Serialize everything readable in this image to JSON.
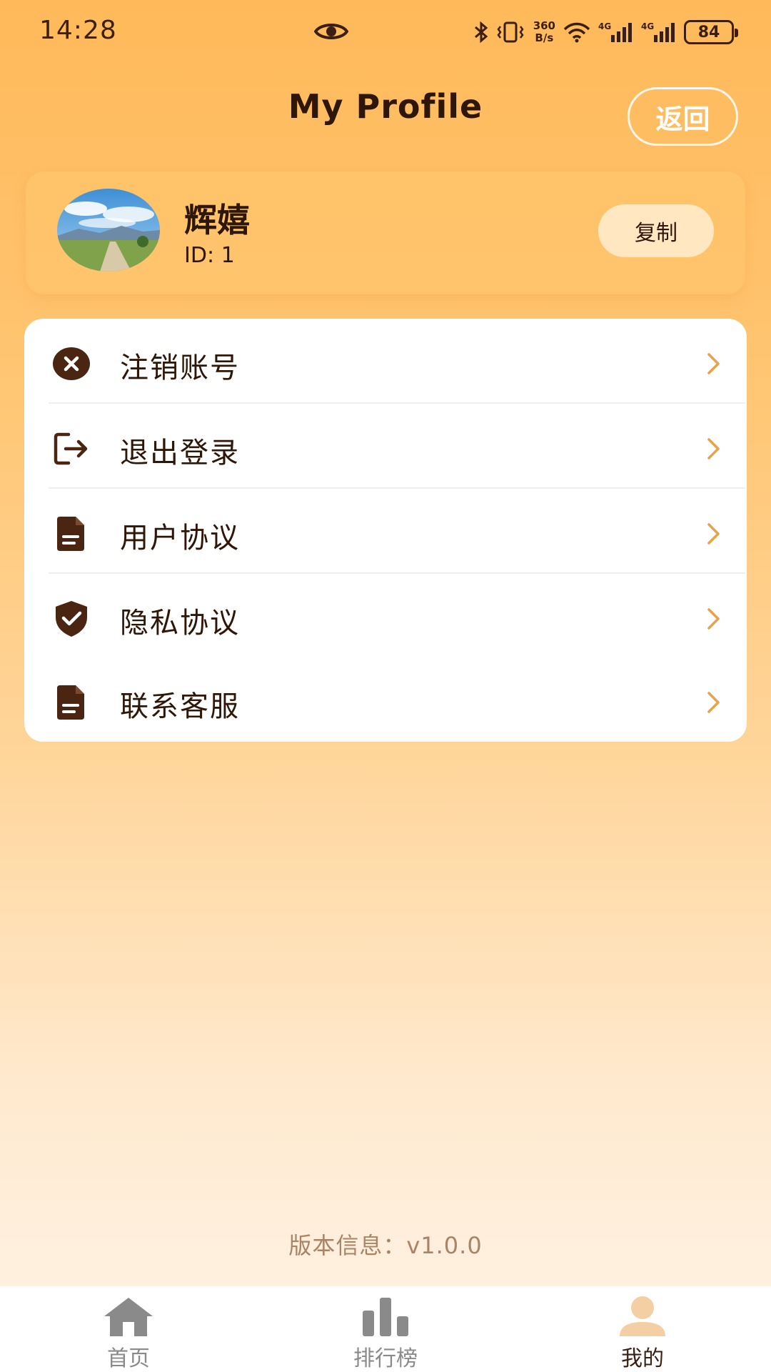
{
  "status_bar": {
    "time": "14:28",
    "speed_value": "360",
    "speed_unit": "B/s",
    "network_1": "4G",
    "network_2": "4G",
    "battery": "84"
  },
  "header": {
    "title": "My Profile",
    "back_label": "返回"
  },
  "profile": {
    "name": "辉嬉",
    "id_text": "ID: 1",
    "copy_label": "复制"
  },
  "menu": {
    "items": [
      {
        "label": "注销账号",
        "icon": "close-circle-icon"
      },
      {
        "label": "退出登录",
        "icon": "logout-icon"
      },
      {
        "label": "用户协议",
        "icon": "document-icon"
      },
      {
        "label": "隐私协议",
        "icon": "shield-check-icon"
      },
      {
        "label": "联系客服",
        "icon": "document-icon"
      }
    ]
  },
  "version": "版本信息：v1.0.0",
  "tabs": [
    {
      "label": "首页",
      "icon": "home-icon",
      "active": false
    },
    {
      "label": "排行榜",
      "icon": "bar-chart-icon",
      "active": false
    },
    {
      "label": "我的",
      "icon": "person-icon",
      "active": true
    }
  ],
  "colors": {
    "accent": "#FFB95A",
    "icon_dark": "#4A2512",
    "chevron": "#E8A24A"
  }
}
